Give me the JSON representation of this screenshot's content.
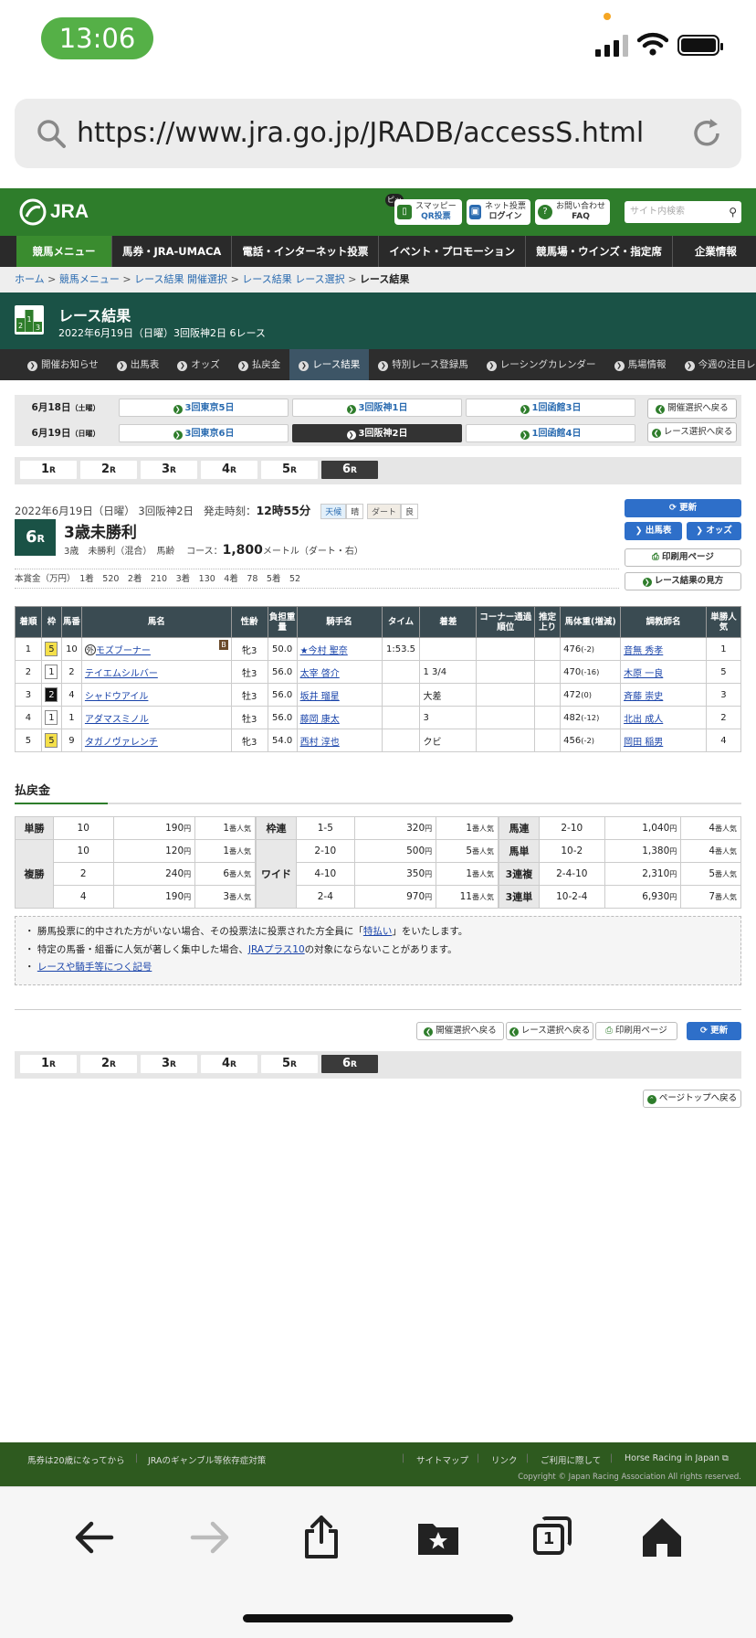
{
  "status_bar": {
    "time": "13:06"
  },
  "browser": {
    "url": "https://www.jra.go.jp/JRADB/accessS.html"
  },
  "header": {
    "logo": "JRA",
    "pi_badge": "ピッ",
    "smappy": {
      "line1": "スマッピー",
      "line2": "QR投票"
    },
    "net": {
      "line1": "ネット投票",
      "line2": "ログイン"
    },
    "faq": {
      "line1": "お問い合わせ",
      "line2": "FAQ"
    },
    "search_placeholder": "サイト内検索"
  },
  "main_nav": [
    "競馬メニュー",
    "馬券・JRA-UMACA",
    "電話・インターネット投票",
    "イベント・プロモーション",
    "競馬場・ウインズ・指定席",
    "企業情報"
  ],
  "breadcrumb": [
    "ホーム",
    "競馬メニュー",
    "レース結果 開催選択",
    "レース結果 レース選択",
    "レース結果"
  ],
  "title": {
    "main": "レース結果",
    "sub": "2022年6月19日（日曜）3回阪神2日 6レース"
  },
  "sub_nav": [
    "開催お知らせ",
    "出馬表",
    "オッズ",
    "払戻金",
    "レース結果",
    "特別レース登録馬",
    "レーシングカレンダー",
    "馬場情報",
    "今週の注目レース"
  ],
  "date_grid": {
    "day1_label": "6月18日",
    "day1_dow": "（土曜）",
    "day2_label": "6月19日",
    "day2_dow": "（日曜）",
    "day1_meets": [
      "3回東京5日",
      "3回阪神1日",
      "1回函館3日"
    ],
    "day2_meets": [
      "3回東京6日",
      "3回阪神2日",
      "1回函館4日"
    ],
    "back_meet": "開催選択へ戻る",
    "back_race": "レース選択へ戻る"
  },
  "race_tabs": {
    "nums": [
      "1",
      "2",
      "3",
      "4",
      "5",
      "6"
    ],
    "suffix": "R"
  },
  "race": {
    "date_text": "2022年6月19日（日曜）  3回阪神2日",
    "start_label": "発走時刻：",
    "start_time": "12時55分",
    "weather_label": "天候",
    "weather": "晴",
    "track_label": "ダート",
    "track": "良",
    "num": "6",
    "num_suffix": "R",
    "name": "3歳未勝利",
    "cond": "3歳　未勝利（混合）　馬齢",
    "course_label": "コース：",
    "distance": "1,800",
    "course_unit": "メートル（ダート・右）",
    "prize": "本賞金（万円）　1着　520　2着　210　3着　130　4着　78　5着　52"
  },
  "race_buttons": {
    "update": "更新",
    "entries": "出馬表",
    "odds": "オッズ",
    "print": "印刷用ページ",
    "howto": "レース結果の見方"
  },
  "result_table": {
    "headers": [
      "着順",
      "枠",
      "馬番",
      "馬名",
      "性齢",
      "負担重量",
      "騎手名",
      "タイム",
      "着差",
      "コーナー通過順位",
      "推定上り",
      "馬体重(増減)",
      "調教師名",
      "単勝人気"
    ],
    "rows": [
      {
        "pos": "1",
        "waku": "5",
        "num": "10",
        "mark": "外",
        "horse": "モズブーナー",
        "blinker": "B",
        "sex": "牝3",
        "weight": "50.0",
        "jockey": "★今村 聖奈",
        "time": "1:53.5",
        "margin": "",
        "corner": "",
        "last": "",
        "body": "476",
        "diff": "(-2)",
        "trainer": "音無 秀孝",
        "pop": "1"
      },
      {
        "pos": "2",
        "waku": "1",
        "num": "2",
        "mark": "",
        "horse": "テイエムシルバー",
        "blinker": "",
        "sex": "牡3",
        "weight": "56.0",
        "jockey": "太宰 啓介",
        "time": "",
        "margin": "1 3/4",
        "corner": "",
        "last": "",
        "body": "470",
        "diff": "(-16)",
        "trainer": "木原 一良",
        "pop": "5"
      },
      {
        "pos": "3",
        "waku": "2",
        "num": "4",
        "mark": "",
        "horse": "シャドウアイル",
        "blinker": "",
        "sex": "牡3",
        "weight": "56.0",
        "jockey": "坂井 瑠星",
        "time": "",
        "margin": "大差",
        "corner": "",
        "last": "",
        "body": "472",
        "diff": "(0)",
        "trainer": "斉藤 崇史",
        "pop": "3"
      },
      {
        "pos": "4",
        "waku": "1",
        "num": "1",
        "mark": "",
        "horse": "アダマスミノル",
        "blinker": "",
        "sex": "牡3",
        "weight": "56.0",
        "jockey": "藤岡 康太",
        "time": "",
        "margin": "3",
        "corner": "",
        "last": "",
        "body": "482",
        "diff": "(-12)",
        "trainer": "北出 成人",
        "pop": "2"
      },
      {
        "pos": "5",
        "waku": "5",
        "num": "9",
        "mark": "",
        "horse": "タガノヴァレンチ",
        "blinker": "",
        "sex": "牝3",
        "weight": "54.0",
        "jockey": "西村 淳也",
        "time": "",
        "margin": "クビ",
        "corner": "",
        "last": "",
        "body": "456",
        "diff": "(-2)",
        "trainer": "岡田 稲男",
        "pop": "4"
      }
    ]
  },
  "payout": {
    "title": "払戻金",
    "yen": "円",
    "pop_suffix": "番人気",
    "tansho": {
      "label": "単勝",
      "num": "10",
      "amount": "190",
      "pop": "1"
    },
    "fukusho": {
      "label": "複勝",
      "rows": [
        {
          "num": "10",
          "amount": "120",
          "pop": "1"
        },
        {
          "num": "2",
          "amount": "240",
          "pop": "6"
        },
        {
          "num": "4",
          "amount": "190",
          "pop": "3"
        }
      ]
    },
    "wakuren": {
      "label": "枠連",
      "num": "1-5",
      "amount": "320",
      "pop": "1"
    },
    "wide": {
      "label": "ワイド",
      "rows": [
        {
          "num": "2-10",
          "amount": "500",
          "pop": "5"
        },
        {
          "num": "4-10",
          "amount": "350",
          "pop": "1"
        },
        {
          "num": "2-4",
          "amount": "970",
          "pop": "11"
        }
      ]
    },
    "umaren": {
      "label": "馬連",
      "num": "2-10",
      "amount": "1,040",
      "pop": "4"
    },
    "umatan": {
      "label": "馬単",
      "num": "10-2",
      "amount": "1,380",
      "pop": "4"
    },
    "sanrenpuku": {
      "label": "3連複",
      "num": "2-4-10",
      "amount": "2,310",
      "pop": "5"
    },
    "sanrentan": {
      "label": "3連単",
      "num": "10-2-4",
      "amount": "6,930",
      "pop": "7"
    }
  },
  "notes": {
    "n1_pre": "勝馬投票に的中された方がいない場合、その投票法に投票された方全員に「",
    "n1_link": "特払い",
    "n1_post": "」をいたします。",
    "n2_pre": "特定の馬番・組番に人気が著しく集中した場合、",
    "n2_link": "JRAプラス10",
    "n2_post": "の対象にならないことがあります。",
    "n3_link": "レースや騎手等につく記号"
  },
  "bottom_buttons": {
    "back_meet": "開催選択へ戻る",
    "back_race": "レース選択へ戻る",
    "print": "印刷用ページ",
    "update": "更新",
    "pagetop": "ページトップへ戻る"
  },
  "footer": {
    "left1": "馬券は20歳になってから",
    "left2": "JRAのギャンブル等依存症対策",
    "sitemap": "サイトマップ",
    "link": "リンク",
    "terms": "ご利用に際して",
    "english": "Horse Racing in Japan",
    "copyright": "Copyright © Japan Racing Association All rights reserved."
  },
  "toolbar": {
    "tabs_count": "1"
  }
}
